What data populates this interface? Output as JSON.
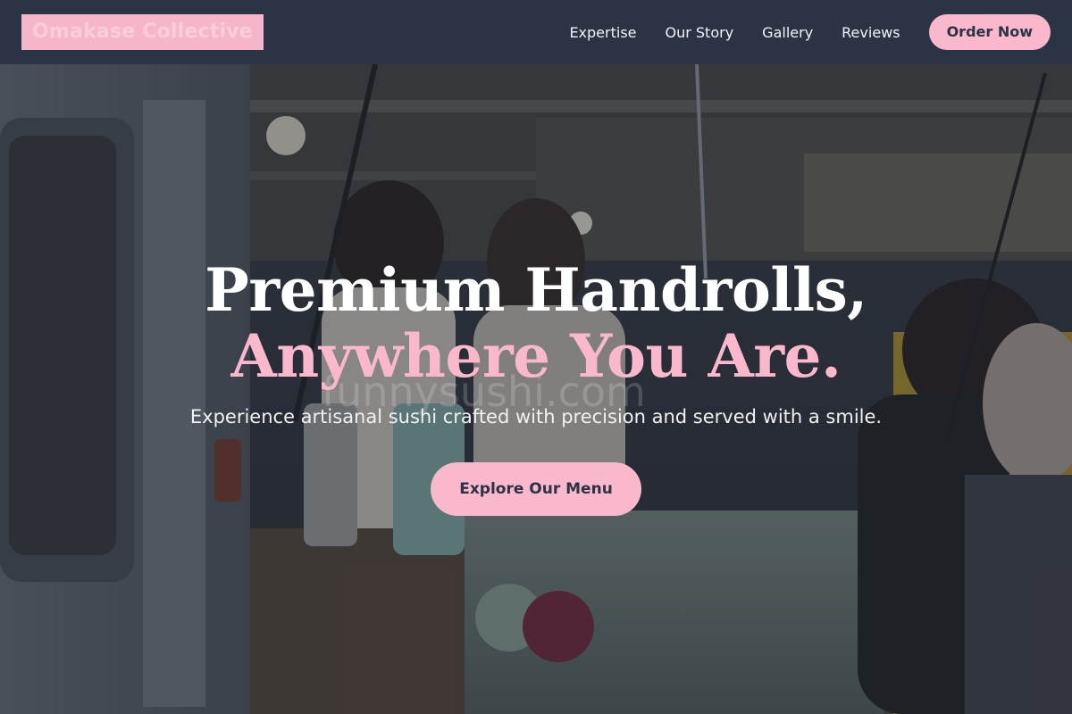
{
  "nav": {
    "brand": "Omakase Collective",
    "links": [
      "Expertise",
      "Our Story",
      "Gallery",
      "Reviews"
    ],
    "cta": "Order Now"
  },
  "hero": {
    "headline_line1": "Premium Handrolls,",
    "headline_line2": "Anywhere You Are.",
    "subtitle": "Experience artisanal sushi crafted with precision and served with a smile.",
    "cta": "Explore Our Menu",
    "watermark": "funnysushi.com"
  },
  "colors": {
    "nav_bg": "#2a3444",
    "accent_pink": "#f9b8cb",
    "headline_white": "#ffffff"
  }
}
